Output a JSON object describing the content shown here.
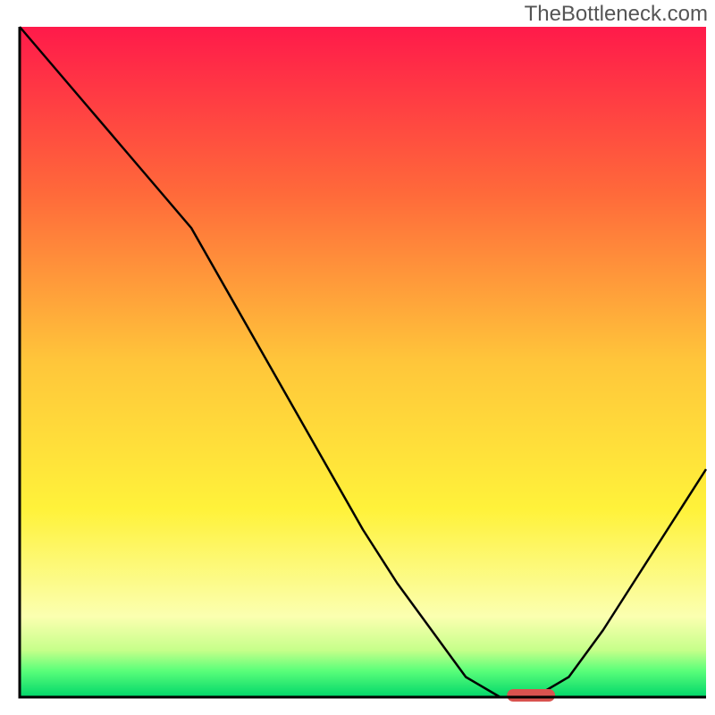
{
  "watermark": "TheBottleneck.com",
  "chart_data": {
    "type": "line",
    "title": "",
    "xlabel": "",
    "ylabel": "",
    "xlim": [
      0,
      100
    ],
    "ylim": [
      0,
      100
    ],
    "x": [
      0,
      5,
      10,
      15,
      20,
      25,
      30,
      35,
      40,
      45,
      50,
      55,
      60,
      65,
      70,
      75,
      80,
      85,
      90,
      95,
      100
    ],
    "values": [
      100,
      94,
      88,
      82,
      76,
      70,
      61,
      52,
      43,
      34,
      25,
      17,
      10,
      3,
      0,
      0,
      3,
      10,
      18,
      26,
      34
    ],
    "minimum_marker": {
      "x_start": 71,
      "x_end": 78,
      "y": 0,
      "color": "#d9534f"
    },
    "gradient_stops": [
      {
        "offset": 0.0,
        "color": "#ff1a4a"
      },
      {
        "offset": 0.25,
        "color": "#ff6a3a"
      },
      {
        "offset": 0.5,
        "color": "#ffc63a"
      },
      {
        "offset": 0.72,
        "color": "#fff23a"
      },
      {
        "offset": 0.88,
        "color": "#fbffb0"
      },
      {
        "offset": 0.93,
        "color": "#c6ff8a"
      },
      {
        "offset": 0.96,
        "color": "#5cff7a"
      },
      {
        "offset": 1.0,
        "color": "#00d66a"
      }
    ],
    "axis_color": "#000000"
  }
}
